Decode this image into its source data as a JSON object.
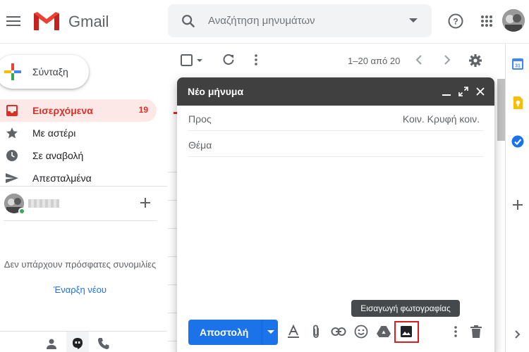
{
  "header": {
    "app_name": "Gmail",
    "search_placeholder": "Αναζήτηση μηνυμάτων",
    "icons": [
      "menu-icon",
      "help-icon",
      "apps-grid-icon"
    ]
  },
  "sidebar": {
    "compose_label": "Σύνταξη",
    "items": [
      {
        "label": "Εισερχόμενα",
        "count": "19",
        "icon": "inbox-icon",
        "active": true
      },
      {
        "label": "Με αστέρι",
        "count": "",
        "icon": "star-icon"
      },
      {
        "label": "Σε αναβολή",
        "count": "",
        "icon": "clock-icon"
      },
      {
        "label": "Απεσταλμένα",
        "count": "",
        "icon": "send-icon"
      }
    ],
    "hangouts_empty": "Δεν υπάρχουν πρόσφατες συνομιλίες",
    "hangouts_start": "Έναρξη νέου"
  },
  "list_toolbar": {
    "range": "1–20 από 20"
  },
  "compose": {
    "title": "Νέο μήνυμα",
    "to_label": "Προς",
    "cc_bcc": "Κοιν. Κρυφή κοιν.",
    "subject_placeholder": "Θέμα",
    "send_label": "Αποστολή",
    "tooltip": "Εισαγωγή φωτογραφίας"
  },
  "colors": {
    "accent": "#1a73e8",
    "inbox_red": "#d93025",
    "compose_header": "#404040",
    "highlight": "#e01b1b"
  }
}
